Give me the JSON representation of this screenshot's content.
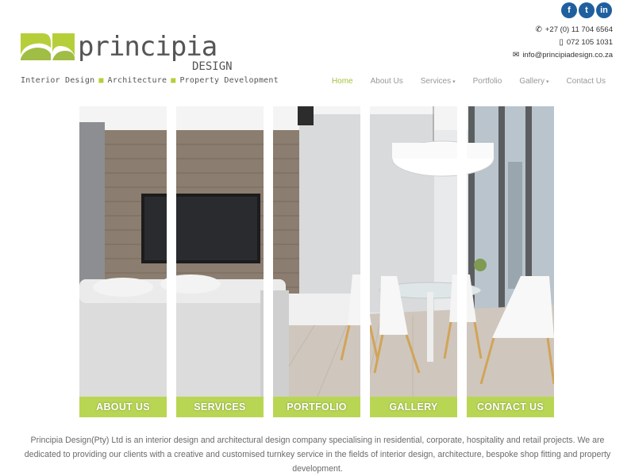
{
  "brand": {
    "logo_text": "principia",
    "logo_sub": "DESIGN",
    "tagline": [
      "Interior Design",
      "Architecture",
      "Property Development"
    ],
    "accent_color": "#a4c23d"
  },
  "social": [
    {
      "name": "facebook-icon",
      "glyph": "f"
    },
    {
      "name": "twitter-icon",
      "glyph": "t"
    },
    {
      "name": "linkedin-icon",
      "glyph": "in"
    }
  ],
  "contact": {
    "phone": "+27 (0) 11 704 6564",
    "mobile": "072 105 1031",
    "email": "info@principiadesign.co.za"
  },
  "nav": {
    "items": [
      {
        "label": "Home",
        "active": true
      },
      {
        "label": "About Us"
      },
      {
        "label": "Services",
        "caret": "▾"
      },
      {
        "label": "Portfolio"
      },
      {
        "label": "Gallery",
        "caret": "▾"
      },
      {
        "label": "Contact Us"
      }
    ]
  },
  "panels": [
    {
      "label": "ABOUT US"
    },
    {
      "label": "SERVICES"
    },
    {
      "label": "PORTFOLIO"
    },
    {
      "label": "GALLERY"
    },
    {
      "label": "CONTACT US"
    }
  ],
  "intro": "Principia Design(Pty) Ltd is an interior design and architectural design company specialising in residential, corporate, hospitality and retail projects. We are dedicated to providing our clients with a creative and customised turnkey service in the fields of interior design, architecture, bespoke shop fitting and property development."
}
